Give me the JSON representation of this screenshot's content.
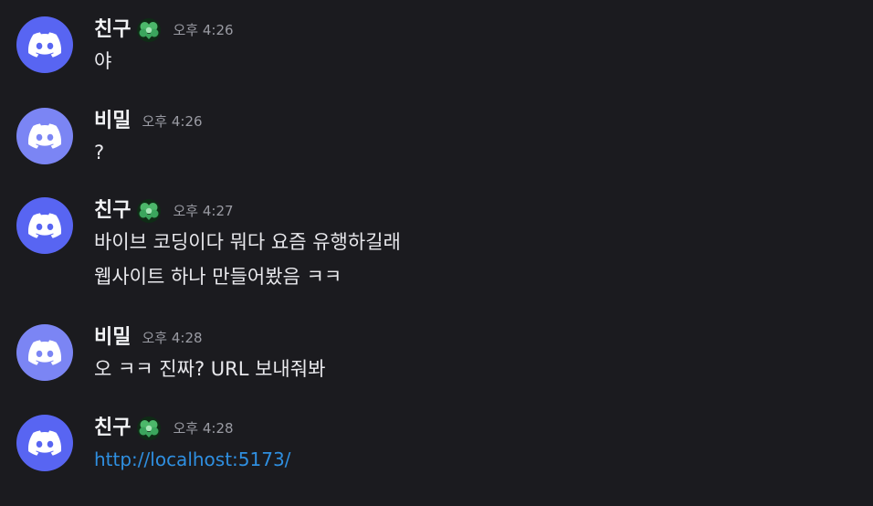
{
  "colors": {
    "background": "#1b1b1f",
    "avatar_blurple": "#5865f2",
    "avatar_light": "#7b85f4",
    "role_green": "#3ba55d",
    "link_blue": "#2f8fe0"
  },
  "avatar_icon": "discord-logo-icon",
  "role_icon": "green-flower-heart-icon",
  "messages": [
    {
      "username": "친구",
      "has_role_icon": true,
      "time": "오후 4:26",
      "lines": [
        "야"
      ]
    },
    {
      "username": "비밀",
      "has_role_icon": false,
      "time": "오후 4:26",
      "lines": [
        "?"
      ]
    },
    {
      "username": "친구",
      "has_role_icon": true,
      "time": "오후 4:27",
      "lines": [
        "바이브 코딩이다 뭐다 요즘 유행하길래",
        "웹사이트 하나 만들어봤음 ㅋㅋ"
      ]
    },
    {
      "username": "비밀",
      "has_role_icon": false,
      "time": "오후 4:28",
      "lines": [
        "오 ㅋㅋ 진짜? URL 보내줘봐"
      ]
    },
    {
      "username": "친구",
      "has_role_icon": true,
      "time": "오후 4:28",
      "lines": [],
      "link": "http://localhost:5173/"
    }
  ]
}
